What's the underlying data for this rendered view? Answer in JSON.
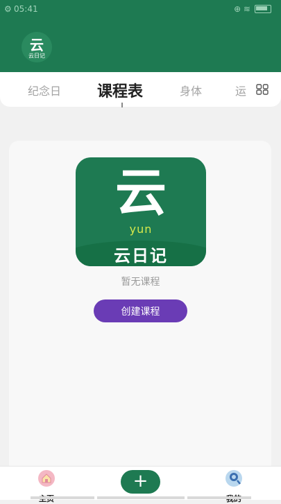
{
  "status_bar": {
    "time": "05:41",
    "gear_glyph": "⚙",
    "network_glyph": "⊕ ≋"
  },
  "header": {
    "logo_text": "云",
    "logo_subtext": "云日记"
  },
  "tabs": [
    {
      "label": "纪念日",
      "active": false
    },
    {
      "label": "课程表",
      "active": true
    },
    {
      "label": "身体",
      "active": false
    },
    {
      "label": "运",
      "active": false
    }
  ],
  "main": {
    "app_icon": {
      "glyph": "云",
      "sub": "yun",
      "name": "云日记"
    },
    "empty_text": "暂无课程",
    "create_button": "创建课程"
  },
  "bottom_nav": {
    "home_label": "主页",
    "add_label": "+",
    "me_label": "我的"
  },
  "colors": {
    "brand": "#1e7a52",
    "accent": "#6a3cb5"
  }
}
